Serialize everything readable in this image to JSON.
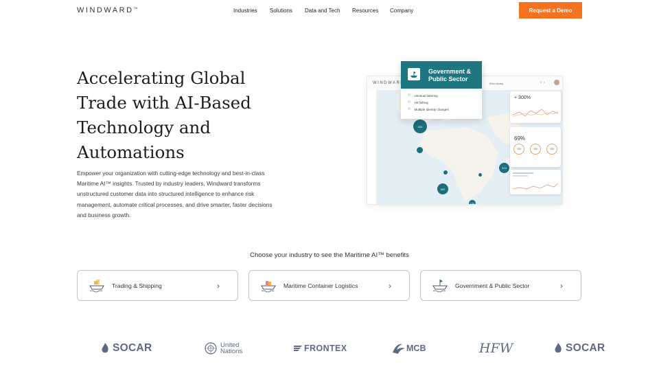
{
  "nav": {
    "brand": "WINDWARD",
    "brand_mark": "TM",
    "links": [
      "Industries",
      "Solutions",
      "Data and Tech",
      "Resources",
      "Company"
    ],
    "cta": "Request a Demo"
  },
  "hero": {
    "title": "Accelerating Global Trade with AI-Based Technology and Automations",
    "description": "Empower your organization with cutting-edge technology and best-in-class Maritime AI™ insights. Trusted by industry leaders, Windward transforms unstructured customer data into structured intelligence to enhance risk management, automate critical processes, and drive smarter, faster decisions and business growth."
  },
  "mockup": {
    "brand": "WINDWARD",
    "topbar_text": "Ekko arkusaj",
    "stat_pct": "300%",
    "stat_pct_sign": "+",
    "score": "69%",
    "ring_values": [
      "100",
      "100",
      "100"
    ],
    "bubbles": [
      "420",
      "300",
      "319",
      "130",
      "210"
    ],
    "gov_card": {
      "title": "Government & Public Sector",
      "items": [
        "Unusual loitering",
        "Hit fishing",
        "Multiple identity changes"
      ]
    },
    "colors": {
      "teal": "#1e7780",
      "map": "#e3eff5",
      "accent": "#f47321"
    }
  },
  "industries": {
    "prompt": "Choose your industry to see the Maritime AI™ benefits",
    "items": [
      {
        "label": "Trading & Shipping",
        "icon": "cargo-ship-icon"
      },
      {
        "label": "Maritime Container Logistics",
        "icon": "container-ship-icon"
      },
      {
        "label": "Government & Public Sector",
        "icon": "patrol-ship-icon"
      }
    ]
  },
  "logos": {
    "socar": "SOCAR",
    "un_line1": "United",
    "un_line2": "Nations",
    "frontex": "FRONTEX",
    "mcb": "MCB",
    "hfw": "HFW",
    "socar2": "SOCAR"
  }
}
